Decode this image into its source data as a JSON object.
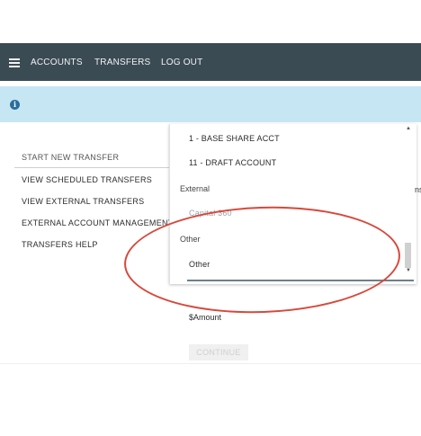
{
  "header": {
    "menu_icon": "hamburger-menu-icon",
    "nav": [
      "ACCOUNTS",
      "TRANSFERS",
      "LOG OUT"
    ],
    "color": "#3b4b54"
  },
  "info_banner": {
    "icon": "info-icon",
    "icon_glyph": "i",
    "color": "#c7e6f3"
  },
  "sidebar": {
    "items": [
      {
        "label": "START NEW TRANSFER"
      },
      {
        "label": "VIEW SCHEDULED TRANSFERS"
      },
      {
        "label": "VIEW EXTERNAL TRANSFERS"
      },
      {
        "label": "EXTERNAL ACCOUNT MANAGEMENT"
      },
      {
        "label": "TRANSFERS HELP"
      }
    ]
  },
  "dropdown": {
    "options": [
      {
        "label": "1 - BASE SHARE ACCT"
      },
      {
        "label": "11 - DRAFT ACCOUNT"
      }
    ],
    "groups": [
      {
        "label": "External",
        "options": [
          {
            "label": "Capital 360"
          }
        ]
      },
      {
        "label": "Other",
        "options": [
          {
            "label": "Other"
          }
        ]
      }
    ]
  },
  "peek_text": "ns",
  "form": {
    "amount_label": "$Amount",
    "continue_label": "CONTINUE"
  },
  "annotation": {
    "color": "#d8483b"
  }
}
